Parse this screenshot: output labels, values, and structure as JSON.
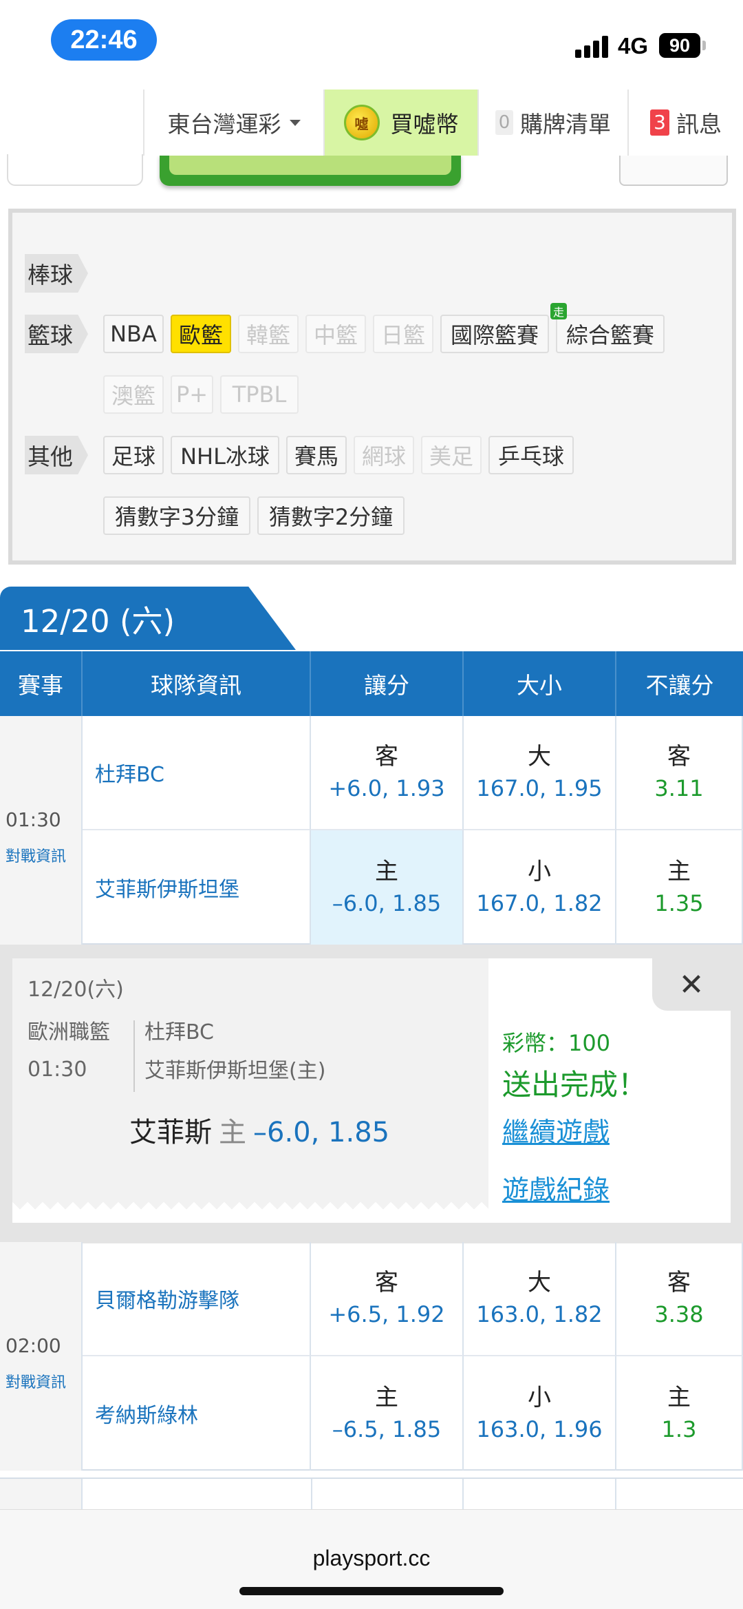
{
  "status": {
    "time": "22:46",
    "network": "4G",
    "battery": "90"
  },
  "nav": {
    "region": "東台灣運彩",
    "buy_coins": "買噓幣",
    "coin_glyph": "噓",
    "cart_count": "0",
    "cart": "購牌清單",
    "msg_count": "3",
    "messages": "訊息"
  },
  "filters": {
    "baseball": "棒球",
    "basketball": "籃球",
    "other": "其他",
    "go_badge": "走",
    "basketball_items": [
      "NBA",
      "歐籃",
      "韓籃",
      "中籃",
      "日籃",
      "國際籃賽",
      "綜合籃賽",
      "澳籃",
      "P+",
      "TPBL"
    ],
    "other_items": [
      "足球",
      "NHL冰球",
      "賽馬",
      "網球",
      "美足",
      "乒乓球",
      "猜數字3分鐘",
      "猜數字2分鐘"
    ],
    "active": "歐籃"
  },
  "date_tab": "12/20 (六)",
  "table_header": [
    "賽事",
    "球隊資訊",
    "讓分",
    "大小",
    "不讓分"
  ],
  "games": [
    {
      "time": "01:30",
      "info": "對戰資訊",
      "away": "杜拜BC",
      "home": "艾菲斯伊斯坦堡",
      "spread": [
        {
          "label": "客",
          "odds": "+6.0, 1.93"
        },
        {
          "label": "主",
          "odds": "–6.0, 1.85"
        }
      ],
      "total": [
        {
          "label": "大",
          "odds": "167.0, 1.95"
        },
        {
          "label": "小",
          "odds": "167.0, 1.82"
        }
      ],
      "moneyline": [
        {
          "label": "客",
          "odds": "3.11"
        },
        {
          "label": "主",
          "odds": "1.35"
        }
      ]
    },
    {
      "time": "02:00",
      "info": "對戰資訊",
      "away": "貝爾格勒游擊隊",
      "home": "考納斯綠林",
      "spread": [
        {
          "label": "客",
          "odds": "+6.5, 1.92"
        },
        {
          "label": "主",
          "odds": "–6.5, 1.85"
        }
      ],
      "total": [
        {
          "label": "大",
          "odds": "163.0, 1.82"
        },
        {
          "label": "小",
          "odds": "163.0, 1.96"
        }
      ],
      "moneyline": [
        {
          "label": "客",
          "odds": "3.38"
        },
        {
          "label": "主",
          "odds": "1.3"
        }
      ]
    }
  ],
  "confirmation": {
    "date": "12/20(六)",
    "league": "歐洲職籃",
    "time": "01:30",
    "away": "杜拜BC",
    "home": "艾菲斯伊斯坦堡(主)",
    "pick_team": "艾菲斯",
    "pick_side": "主",
    "pick_value": "–6.0, 1.85",
    "coins": "彩幣：100",
    "done": "送出完成！",
    "continue": "繼續遊戲",
    "history": "遊戲紀錄",
    "close": "✕"
  },
  "url": "playsport.cc"
}
